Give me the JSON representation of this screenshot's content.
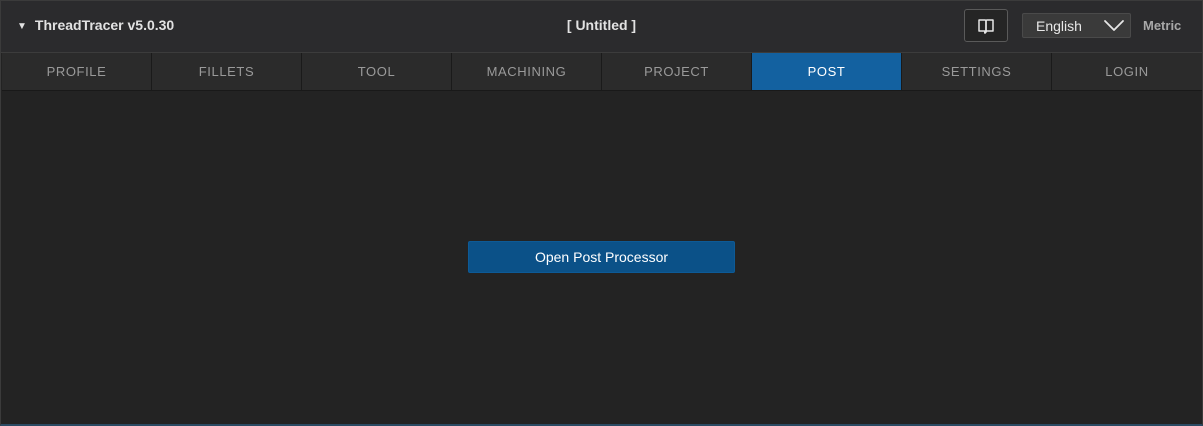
{
  "app": {
    "title": "ThreadTracer v5.0.30",
    "document_title": "[ Untitled ]"
  },
  "header": {
    "help_icon": "book-icon",
    "language": {
      "selected": "English",
      "dropdown_icon": "chevron-down-icon"
    },
    "units": "Metric"
  },
  "tabs": [
    {
      "label": "PROFILE",
      "active": false
    },
    {
      "label": "FILLETS",
      "active": false
    },
    {
      "label": "TOOL",
      "active": false
    },
    {
      "label": "MACHINING",
      "active": false
    },
    {
      "label": "PROJECT",
      "active": false
    },
    {
      "label": "POST",
      "active": true
    },
    {
      "label": "SETTINGS",
      "active": false
    },
    {
      "label": "LOGIN",
      "active": false
    }
  ],
  "main": {
    "open_post_processor_label": "Open Post Processor"
  },
  "colors": {
    "accent": "#1361a0",
    "button": "#0b5188",
    "background": "#232323",
    "titlebar": "#2b2b2d"
  }
}
